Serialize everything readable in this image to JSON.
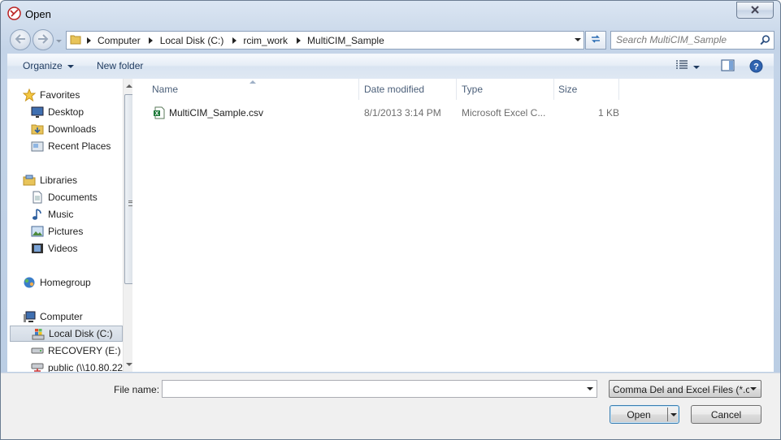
{
  "window": {
    "title": "Open"
  },
  "address": {
    "crumbs": [
      "Computer",
      "Local Disk (C:)",
      "rcim_work",
      "MultiCIM_Sample"
    ]
  },
  "search": {
    "placeholder": "Search MultiCIM_Sample"
  },
  "toolbar": {
    "organize": "Organize",
    "new_folder": "New folder"
  },
  "nav": {
    "favorites": "Favorites",
    "desktop": "Desktop",
    "downloads": "Downloads",
    "recent_places": "Recent Places",
    "libraries": "Libraries",
    "documents": "Documents",
    "music": "Music",
    "pictures": "Pictures",
    "videos": "Videos",
    "homegroup": "Homegroup",
    "computer": "Computer",
    "local_disk": "Local Disk (C:)",
    "recovery": "RECOVERY (E:)",
    "public": "public (\\\\10.80.22"
  },
  "columns": {
    "name": "Name",
    "date": "Date modified",
    "type": "Type",
    "size": "Size"
  },
  "files": [
    {
      "name": "MultiCIM_Sample.csv",
      "date": "8/1/2013 3:14 PM",
      "type": "Microsoft Excel C...",
      "size": "1 KB"
    }
  ],
  "bottom": {
    "file_name_label": "File name:",
    "file_name_value": "",
    "file_type": "Comma Del and Excel Files (*.csv",
    "open": "Open",
    "cancel": "Cancel"
  },
  "colors": {
    "accent": "#1e3a5f",
    "selection": "#d3dbe5"
  }
}
